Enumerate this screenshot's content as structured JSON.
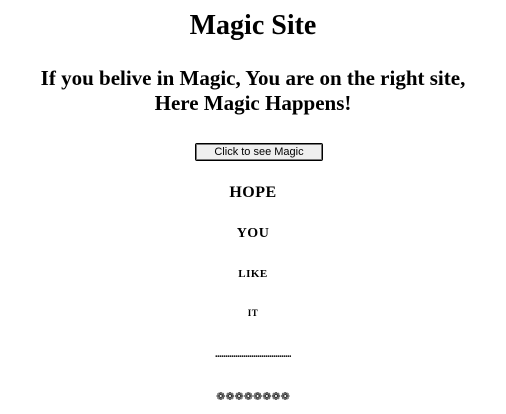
{
  "header": {
    "title": "Magic Site",
    "tagline_line1": "If you belive in Magic, You are on the right site,",
    "tagline_line2": "Here Magic Happens!"
  },
  "main": {
    "button_label": "Click to see Magic",
    "words": [
      "HOPE",
      "YOU",
      "LIKE",
      "IT"
    ],
    "dots": "......................................",
    "flowers": "❁❁❁❁❁❁❁❁"
  }
}
